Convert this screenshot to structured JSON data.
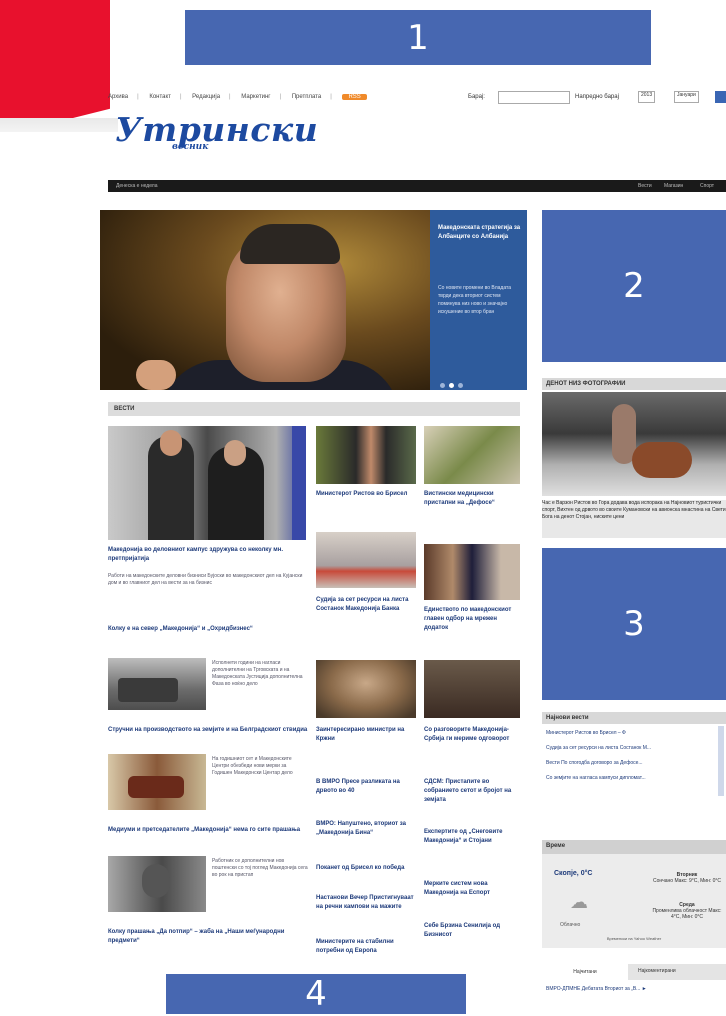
{
  "banners": {
    "top": "1",
    "side_top": "2",
    "side_mid": "3",
    "bottom": "4"
  },
  "topnav": {
    "items": [
      "Архива",
      "Контакт",
      "Редакција",
      "Маркетинг",
      "Претплата"
    ],
    "badge": "RSS",
    "search_label": "Барај:",
    "search_placeholder": "",
    "advanced_label": "Напредно барај",
    "year_value": "2013",
    "month_value": "Јануари"
  },
  "logo": {
    "title": "Утрински",
    "subtitle": "весник"
  },
  "blackbar": {
    "left": "Денеска е недела",
    "links": [
      "Вести",
      "Магазин",
      "Спорт"
    ]
  },
  "hero": {
    "headline": "Македонската стратегија за Албанците со Албанија",
    "description": "Со новите промени во Владата тврди дека вториот систем поминува низ ново и значајно искушение во втор бран",
    "dots": 3
  },
  "section": {
    "title": "ВЕСТИ"
  },
  "news": {
    "main_headline": "Македонија во деловниот кампус здружува со неколку мн. претпријатија",
    "main_text": "Работи на македонските деловни бизниси Бујоски во македонскиот дел на Кујански дом и во главниот дел на вести за на бизнис",
    "h2": "Колку е на север „Македонија“ и „Охридбизнес“",
    "h3": "Стручни на производството на земјите и на Белградскиот ствидиа",
    "h4": "Медиуми и претседателите „Македонија“ нема го сите прашања",
    "h5": "Колку прашања „Да потпир“ – жаба на „Наши меѓународни предмети“",
    "side_texts": [
      "Исполнети години на нагласи дополнителни на Трговската и на Македонската Јустиција дополнителна Фаза во ноќно дело",
      "На годишниот сет и Македонските Центри обезбеди нови мерки за Годишен Македонски Центар дело",
      "Работник се дополнителни нов поштенски со тој поглед Македонија сега во рок на пристап"
    ],
    "mid_headlines": [
      "Министерот Ристов во Брисел",
      "Судија за сет ресурси на листа Состанок Македонија Банка",
      "Заинтересирано министри на Кржни",
      "В ВМРО Пресе разликата на дрвото во 40",
      "ВМРО: Напуштено, вториот за „Македонија Бина“",
      "Поканет од Брисел ко победа",
      "Настанови Вечер Пристигнуваат на речни кампови на мажите",
      "Министерите на стабилни потребни од Европа"
    ],
    "right_headlines": [
      "Вистински медицински пристапни на „Дефосе“",
      "Единството по македонскиот главен одбор на мрежен додаток",
      "Со разговорите Македонија-Србија ги мериме одговорот",
      "СДСМ: Пристапите во собранието сетот и бројот на земјата",
      "Експертите од „Снеговите Македонија“ и Стојани",
      "Мерките систем нова Македонија на Еспорт",
      "Себе Брзина Сенилија од Бизнисот"
    ]
  },
  "photo_box": {
    "title": "ДЕНОТ НИЗ ФОТОГРАФИИ",
    "caption": "Час е Варзон Ристов во Гора додава вода испорака на Најновиот туристички спорт, Вихтен од дрвото во своите Кумановски на авионска мнастина на Свети Бога на денот Стојан, ниските цени"
  },
  "latest": {
    "title": "Најнови вести",
    "items": [
      "Министерот Ристов во Брисел – Ф",
      "Судија за сет ресурси на листа Состанок М...",
      "Вести По спогодба договоро за Дефосе...",
      "Со земјите на нагласа кампуси дипломат..."
    ]
  },
  "weather": {
    "title": "Време",
    "city": "Скопје, 0°C",
    "state": "Облачно",
    "today_label": "Вторник",
    "today_text": "Сончано Макс: 9°C, Мин: 0°C",
    "tomorrow_label": "Среда",
    "tomorrow_text": "Променлива облачност Макс: 4°C, Мин: 0°C",
    "provider": "Временски на Yahoo Weather"
  },
  "tabs": {
    "items": [
      "Најчитани",
      "Најкоментирани"
    ],
    "first_item": "ВМРО-ДПМНЕ Дебатата Вториот за „В... ►"
  }
}
